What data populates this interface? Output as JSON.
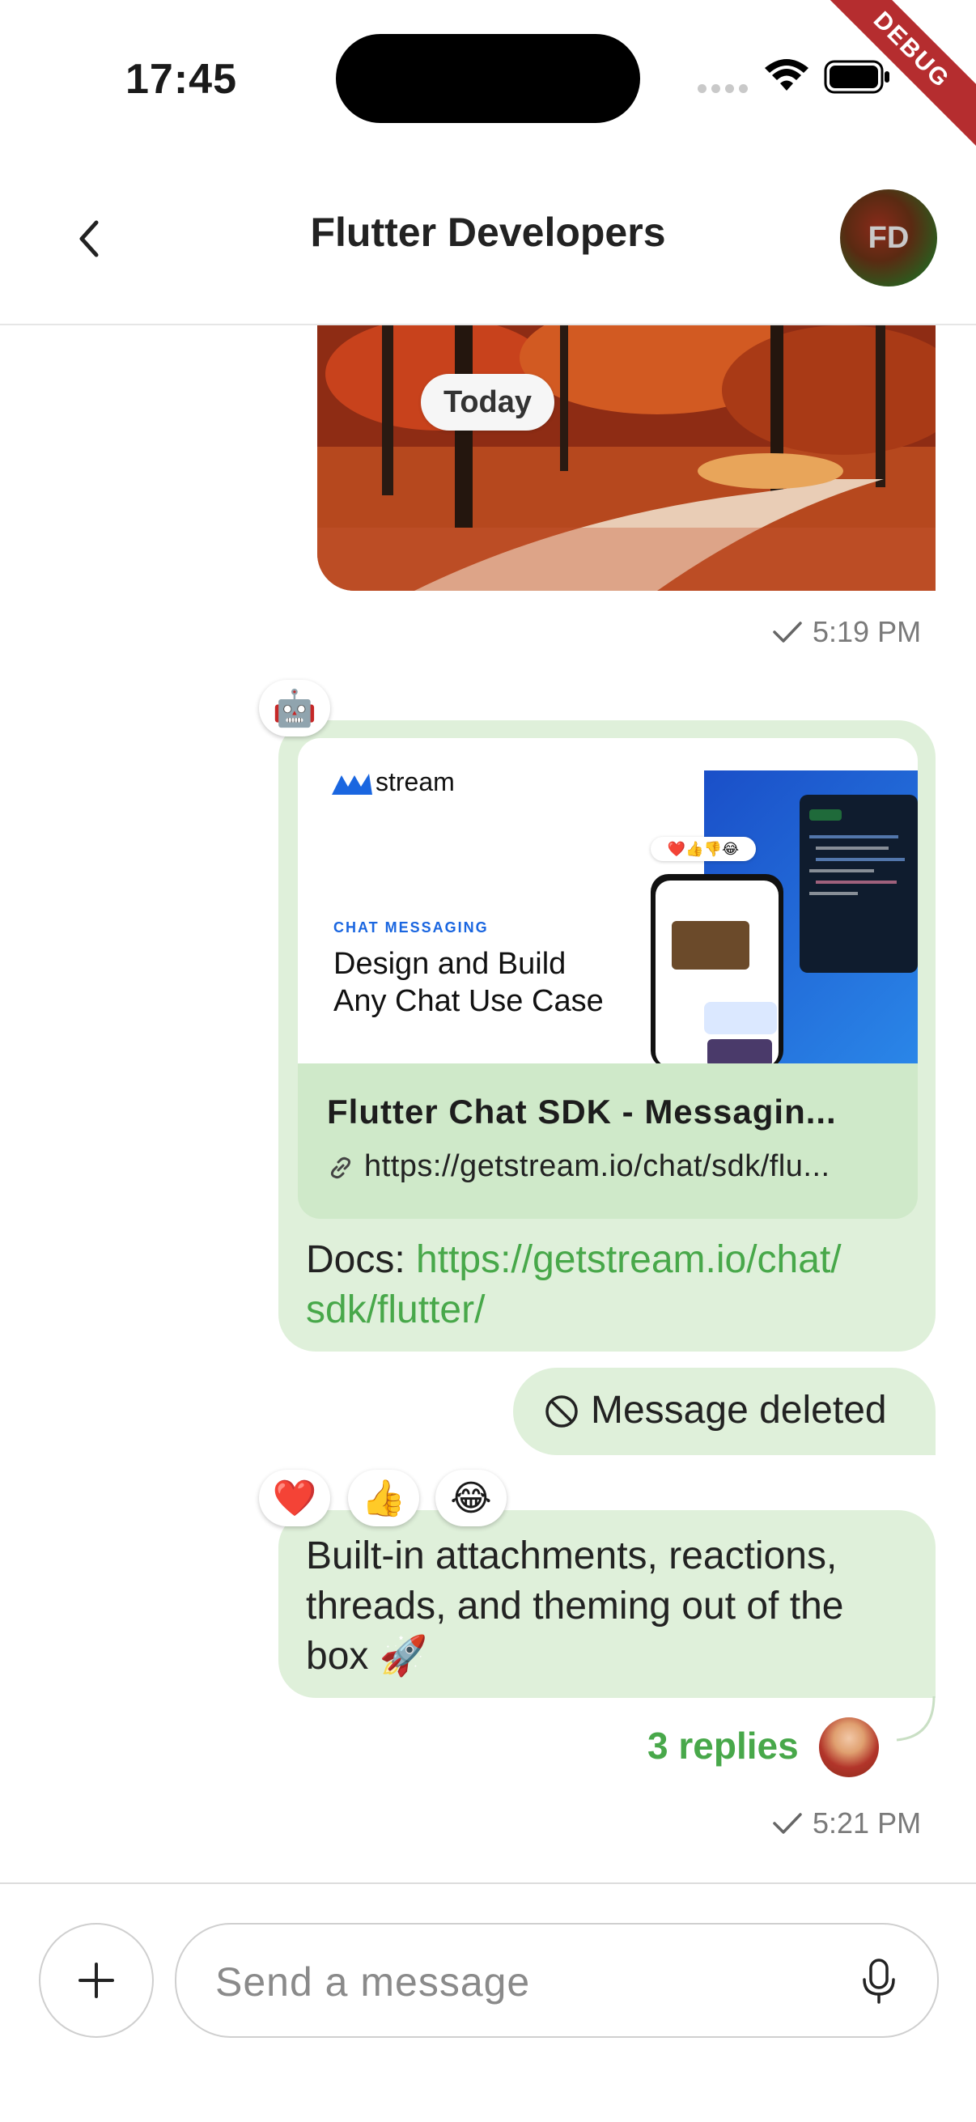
{
  "status_bar": {
    "time": "17:45",
    "debug_banner": "DEBUG"
  },
  "header": {
    "title": "Flutter Developers",
    "avatar_initials": "FD",
    "back_icon": "chevron-left-icon"
  },
  "date_divider": "Today",
  "messages": [
    {
      "type": "image",
      "timestamp": "5:19 PM",
      "status": "sent"
    },
    {
      "type": "link",
      "reaction": "🤖",
      "preview": {
        "brand": "stream",
        "tag": "CHAT MESSAGING",
        "headline_line1": "Design and Build",
        "headline_line2": "Any Chat Use Case",
        "title": "Flutter Chat SDK - Messagin...",
        "url": "https://getstream.io/chat/sdk/flu..."
      },
      "text_prefix": "Docs: ",
      "link_line1": "https://getstream.io/chat/",
      "link_line2": "sdk/flutter/"
    },
    {
      "type": "deleted",
      "text": "Message deleted"
    },
    {
      "type": "text",
      "reactions": [
        "❤️",
        "👍",
        "😂"
      ],
      "line1": "Built-in attachments, reactions,",
      "line2": "threads, and theming out of the",
      "line3": "box 🚀",
      "replies": "3 replies",
      "timestamp": "5:21 PM",
      "status": "sent"
    }
  ],
  "composer": {
    "placeholder": "Send a message",
    "plus_icon": "plus-icon",
    "mic_icon": "mic-icon"
  },
  "colors": {
    "bubble": "#dff0da",
    "accent": "#48a84a",
    "link_preview_bg": "#cfe9c9"
  }
}
